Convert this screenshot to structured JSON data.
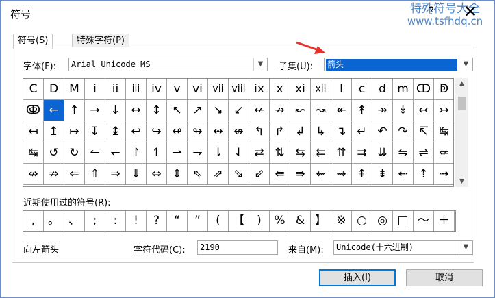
{
  "window": {
    "title": "符号",
    "help": "?",
    "close": "✕"
  },
  "watermark": {
    "line1": "特殊符号大全",
    "line2": "www.tsfhdq.cn"
  },
  "tabs": [
    {
      "label": "符号(S)"
    },
    {
      "label": "特殊字符(P)"
    }
  ],
  "font": {
    "label": "字体(F):",
    "value": "Arial Unicode MS"
  },
  "subset": {
    "label": "子集(U):",
    "value": "箭头"
  },
  "grid_rows": [
    [
      "C",
      "D",
      "M",
      "i",
      "ii",
      "iii",
      "iv",
      "v",
      "vi",
      "vii",
      "viii",
      "ix",
      "x",
      "xi",
      "xii",
      "l",
      "c",
      "d",
      "m",
      "ↀ",
      "ↁ"
    ],
    [
      "ↂ",
      "←",
      "↑",
      "→",
      "↓",
      "↔",
      "↕",
      "↖",
      "↗",
      "↘",
      "↙",
      "↚",
      "↛",
      "↜",
      "↝",
      "↞",
      "↟",
      "↠",
      "↡",
      "↢",
      "↣"
    ],
    [
      "↤",
      "↥",
      "↦",
      "↧",
      "↨",
      "↩",
      "↪",
      "↫",
      "↬",
      "↭",
      "↮",
      "↰",
      "↱",
      "↲",
      "↳",
      "↴",
      "↵",
      "↶",
      "↷",
      "↸",
      "↹"
    ],
    [
      "↹",
      "↺",
      "↻",
      "↼",
      "↽",
      "↾",
      "↿",
      "⇀",
      "⇁",
      "⇂",
      "⇃",
      "⇄",
      "⇅",
      "⇆",
      "⇇",
      "⇈",
      "⇉",
      "⇊",
      "⇋",
      "⇌",
      "⇍"
    ],
    [
      "⇎",
      "⇏",
      "⇐",
      "⇑",
      "⇒",
      "⇓",
      "⇔",
      "⇕",
      "⇖",
      "⇗",
      "⇘",
      "⇙",
      "⇚",
      "⇛",
      "⇜",
      "⇝",
      "⇞",
      "⇟",
      "⇠",
      "⇡",
      "⇢"
    ]
  ],
  "recent": {
    "label": "近期使用过的符号(R):",
    "items": [
      ",",
      "。",
      "、",
      ";",
      ":",
      "!",
      "?",
      "“",
      "”",
      "(",
      "【",
      ")",
      "%",
      "&",
      "】",
      "※",
      "○",
      "◎",
      "□",
      "～",
      "＋"
    ]
  },
  "char_name": "向左箭头",
  "char_code": {
    "label": "字符代码(C):",
    "value": "2190"
  },
  "from": {
    "label": "来自(M):",
    "value": "Unicode(十六进制)"
  },
  "buttons": {
    "insert": "插入(I)",
    "cancel": "取消"
  },
  "colors": {
    "selection": "#0a64d2",
    "watermark": "#4f86c6",
    "arrow": "#e8322b"
  }
}
